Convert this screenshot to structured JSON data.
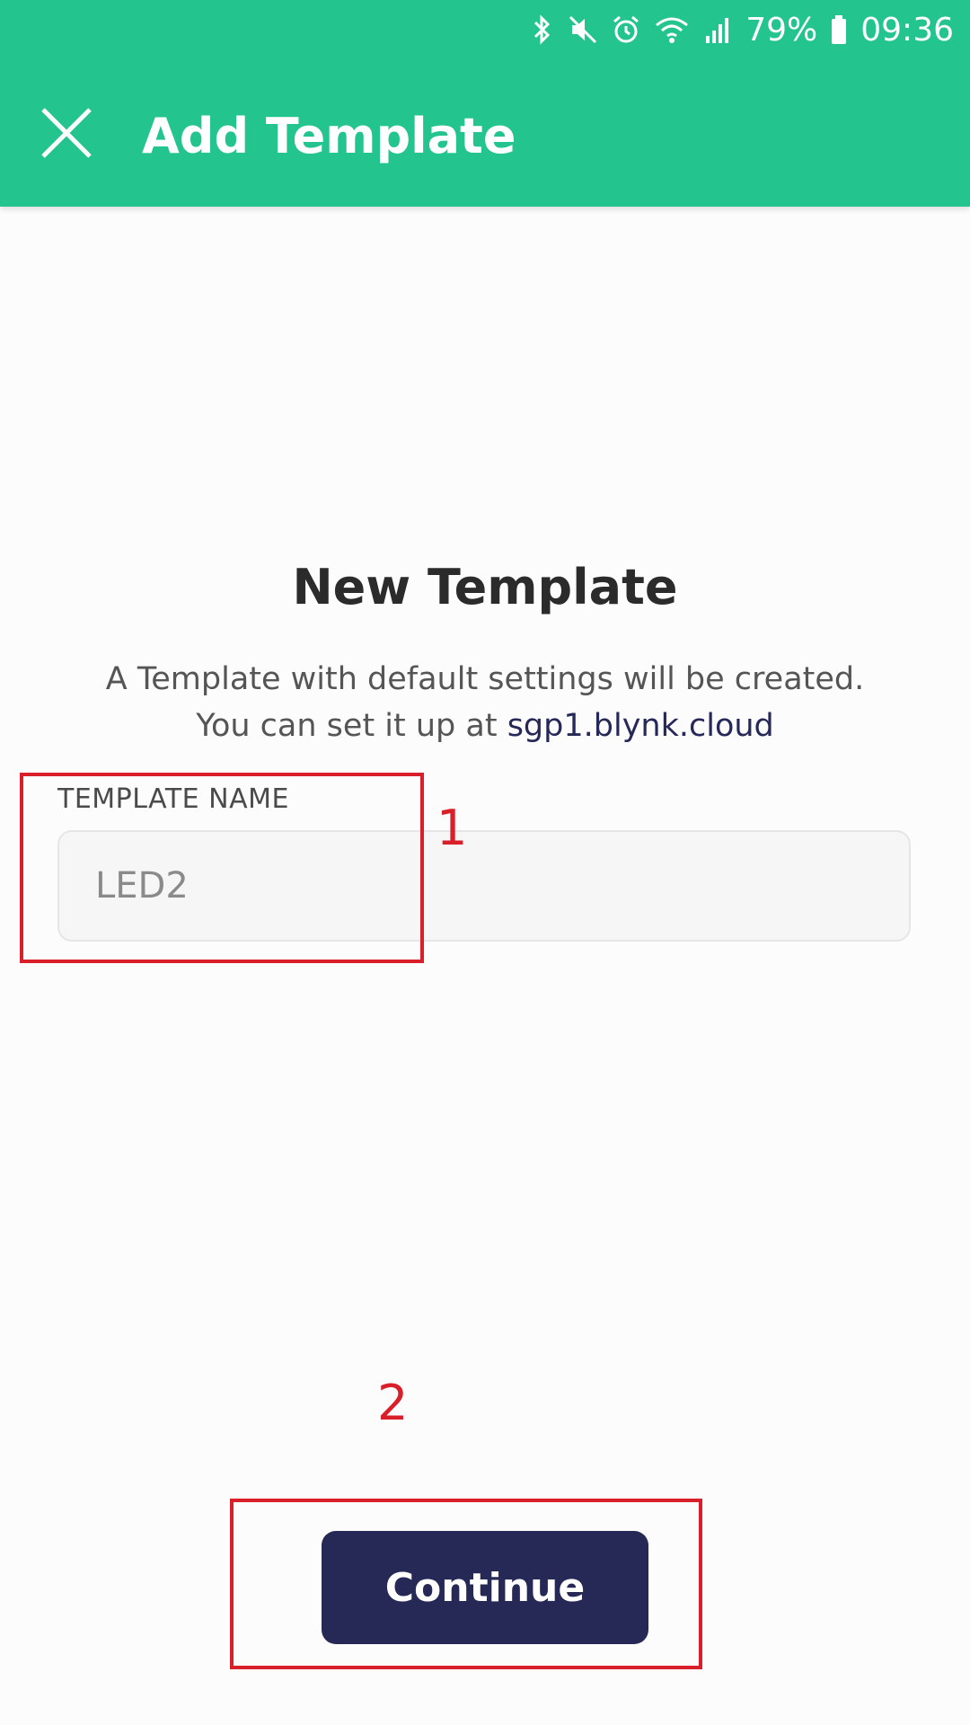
{
  "status_bar": {
    "battery": "79%",
    "time": "09:36",
    "icons": [
      "bluetooth-icon",
      "mute-icon",
      "alarm-icon",
      "wifi-icon",
      "signal-icon",
      "battery-icon"
    ]
  },
  "app_bar": {
    "title": "Add Template",
    "close_icon": "close-icon",
    "color": "#24c48e"
  },
  "main": {
    "heading": "New Template",
    "description_line1": "A Template with default settings will be created.",
    "description_line2_prefix": "You can set it up at ",
    "description_link": "sgp1.blynk.cloud"
  },
  "form": {
    "label": "TEMPLATE NAME",
    "value": "LED2"
  },
  "annotations": {
    "box1_label": "1",
    "box2_label": "2",
    "color": "#d9202a"
  },
  "actions": {
    "continue_label": "Continue",
    "continue_color": "#262855"
  }
}
